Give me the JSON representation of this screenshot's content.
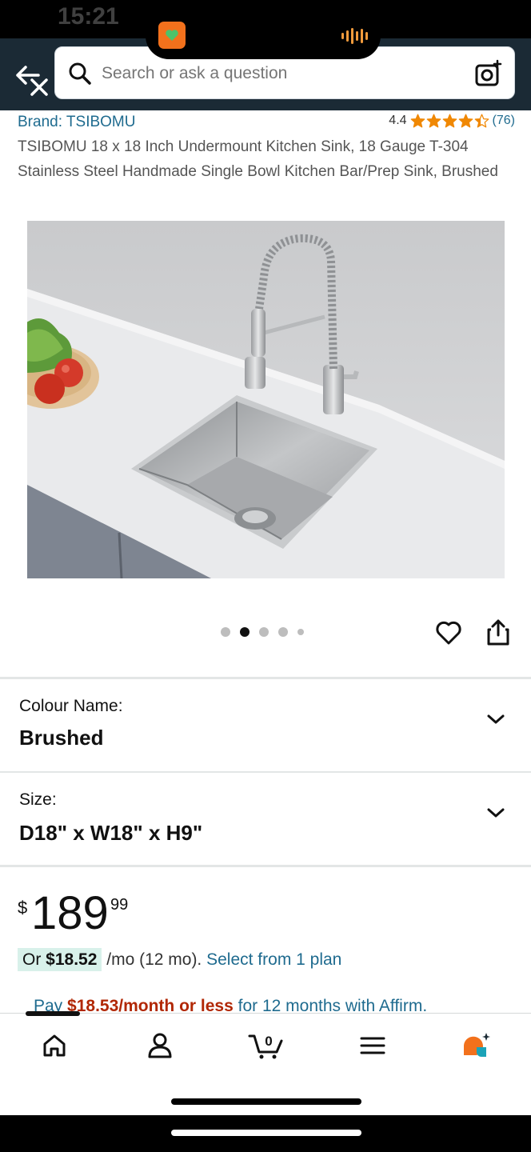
{
  "status_bar": {
    "time": "15:21"
  },
  "search": {
    "placeholder": "Search or ask a question"
  },
  "product": {
    "brand": "Brand: TSIBOMU",
    "rating_value": "4.4",
    "rating_stars": 4.4,
    "rating_count": "(76)",
    "title": "TSIBOMU 18 x 18 Inch Undermount Kitchen Sink, 18 Gauge T-304 Stainless Steel Handmade Single Bowl Kitchen Bar/Prep Sink, Brushed",
    "image_alt": "stainless steel undermount kitchen sink with faucet",
    "image_count": 5,
    "image_active_index": 2
  },
  "options": {
    "colour": {
      "label": "Colour Name:",
      "value": "Brushed"
    },
    "size": {
      "label": "Size:",
      "value": "D18\" x W18\" x H9\""
    }
  },
  "price": {
    "symbol": "$",
    "whole": "189",
    "fraction": "99"
  },
  "installment": {
    "prefix": "Or ",
    "amount": "$18.52",
    "suffix": " /mo (12 mo). ",
    "link": "Select from 1 plan"
  },
  "affirm": {
    "prefix": "Pay ",
    "amount": "$18.53/month or less",
    "suffix": " for 12 months with Affirm."
  },
  "bottom_nav": {
    "items": [
      {
        "icon": "home-icon"
      },
      {
        "icon": "account-icon"
      },
      {
        "icon": "cart-icon",
        "count": "0"
      },
      {
        "icon": "menu-icon"
      },
      {
        "icon": "rufus-icon"
      }
    ]
  },
  "colors": {
    "header_bg": "#1b2a35",
    "link": "#1f6b8f",
    "star": "#f08804",
    "price_highlight": "#d8f1ea",
    "affirm_amount": "#b12704"
  }
}
